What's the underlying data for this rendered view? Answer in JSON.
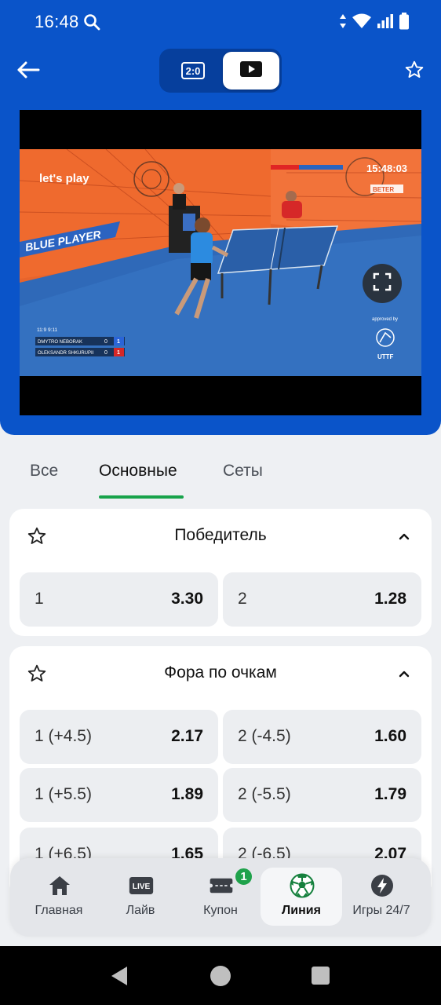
{
  "status_bar": {
    "time": "16:48"
  },
  "header": {
    "score_chip": "2:0",
    "back_icon": "arrow-left-icon",
    "favorite_icon": "star-outline-icon",
    "video_icon": "play-icon",
    "accent": "#0a54c9"
  },
  "video": {
    "overlay_brand": "let's play",
    "overlay_banner": "BLUE PLAYER",
    "clock": "15:48:03",
    "sponsor": "BETER",
    "approved_by": "approved by",
    "federation": "UTTF",
    "scoreboard": {
      "header": "11:9   9:11",
      "players": [
        {
          "name": "DMYTRO NEBORAK",
          "sets": "0",
          "points": "1"
        },
        {
          "name": "OLEKSANDR SHKURUPII",
          "sets": "0",
          "points": "1"
        }
      ]
    },
    "fullscreen_icon": "fullscreen-icon"
  },
  "tabs": [
    {
      "label": "Все"
    },
    {
      "label": "Основные",
      "active": true
    },
    {
      "label": "Сеты"
    }
  ],
  "markets": [
    {
      "title": "Победитель",
      "odds": [
        {
          "label": "1",
          "value": "3.30"
        },
        {
          "label": "2",
          "value": "1.28"
        }
      ]
    },
    {
      "title": "Фора по очкам",
      "odds": [
        {
          "label": "1 (+4.5)",
          "value": "2.17"
        },
        {
          "label": "2 (-4.5)",
          "value": "1.60"
        },
        {
          "label": "1 (+5.5)",
          "value": "1.89"
        },
        {
          "label": "2 (-5.5)",
          "value": "1.79"
        },
        {
          "label": "1 (+6.5)",
          "value": "1.65"
        },
        {
          "label": "2 (-6.5)",
          "value": "2.07"
        }
      ]
    }
  ],
  "bottom_nav": [
    {
      "label": "Главная",
      "icon": "home-icon"
    },
    {
      "label": "Лайв",
      "icon": "live-icon",
      "icon_text": "LIVE"
    },
    {
      "label": "Купон",
      "icon": "ticket-icon",
      "badge": "1"
    },
    {
      "label": "Линия",
      "icon": "soccer-ball-icon",
      "active": true
    },
    {
      "label": "Игры 24/7",
      "icon": "lightning-icon"
    }
  ]
}
